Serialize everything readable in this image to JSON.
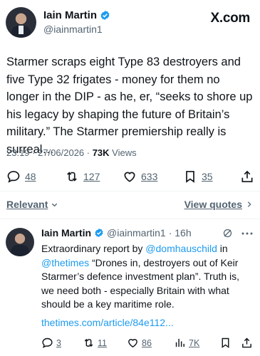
{
  "brand": "X.com",
  "tweet": {
    "author_name": "Iain Martin",
    "author_handle": "@iainmartin1",
    "text": "Starmer scraps eight Type 83 destroyers and five Type 32 frigates - money for them no longer in the DIP - as he, er, “seeks to shore up his legacy by shaping the future of Britain’s military.” The Starmer premiership really is surreal…",
    "time": "23:19 · 27/06/2026 · ",
    "views_count": "73K",
    "views_label": " Views",
    "replies": "48",
    "reposts": "127",
    "likes": "633",
    "bookmarks": "35"
  },
  "sort": {
    "relevant_label": "Relevant",
    "view_quotes_label": "View quotes"
  },
  "reply": {
    "author_name": "Iain Martin",
    "author_handle": "@iainmartin1",
    "age": "· 16h",
    "text_1": "Extraordinary report by ",
    "mention_1": "@domhauschild",
    "text_2": " in ",
    "mention_2": "@thetimes",
    "text_3": " “Drones in, destroyers out of Keir Starmer’s defence investment plan”. Truth is, we need both - especially Britain with what should be a key maritime role.",
    "link": "thetimes.com/article/84e112...",
    "replies": "3",
    "reposts": "11",
    "likes": "86",
    "views": "7K"
  },
  "colors": {
    "accent": "#1d9bf0",
    "muted": "#536471",
    "text": "#0f1419"
  }
}
